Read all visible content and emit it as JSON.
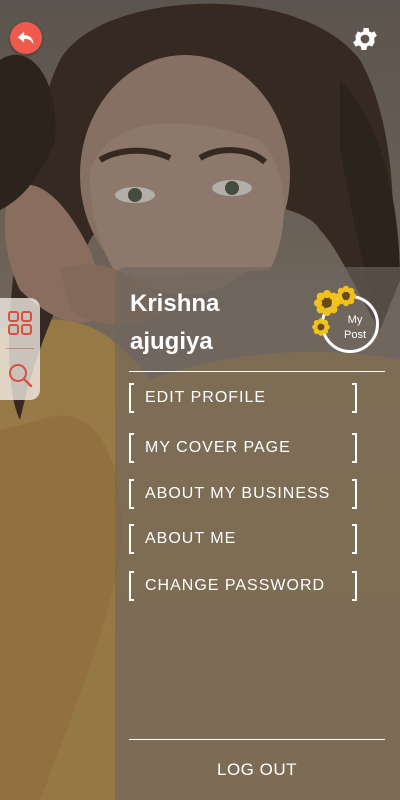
{
  "profile": {
    "first_name": "Krishna",
    "last_name": "ajugiya"
  },
  "my_post": {
    "line1": "My",
    "line2": "Post"
  },
  "menu": [
    {
      "label": "EDIT PROFILE"
    },
    {
      "label": "MY COVER PAGE"
    },
    {
      "label": "ABOUT MY BUSINESS"
    },
    {
      "label": "ABOUT ME"
    },
    {
      "label": "CHANGE PASSWORD"
    }
  ],
  "logout": {
    "label": "LOG OUT"
  },
  "icons": {
    "back": "undo-arrow-icon",
    "settings": "gear-icon",
    "grid": "grid-icon",
    "search": "search-icon",
    "flowers": "sunflower-icon"
  },
  "colors": {
    "back_button": "#f05a4c",
    "side_tool_icons": "#d9503f",
    "panel_text": "#ffffff"
  }
}
